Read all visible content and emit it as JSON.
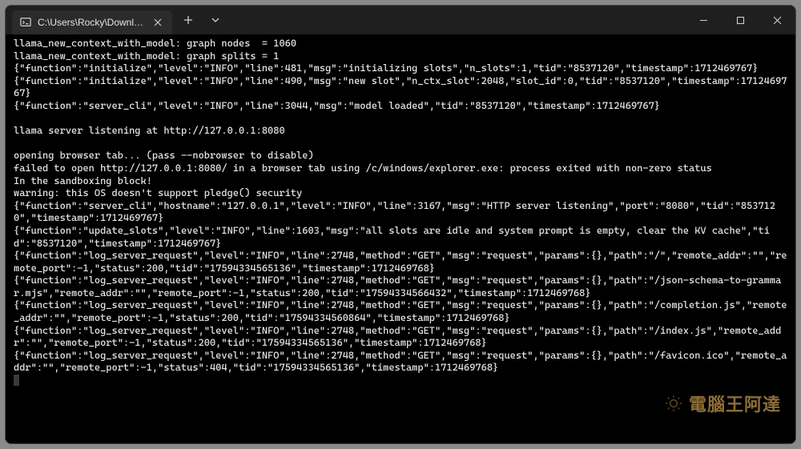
{
  "title": "C:\\Users\\Rocky\\Downloads\\la",
  "terminal_lines": [
    "llama_new_context_with_model: graph nodes  = 1060",
    "llama_new_context_with_model: graph splits = 1",
    "{\"function\":\"initialize\",\"level\":\"INFO\",\"line\":481,\"msg\":\"initializing slots\",\"n_slots\":1,\"tid\":\"8537120\",\"timestamp\":1712469767}",
    "{\"function\":\"initialize\",\"level\":\"INFO\",\"line\":490,\"msg\":\"new slot\",\"n_ctx_slot\":2048,\"slot_id\":0,\"tid\":\"8537120\",\"timestamp\":1712469767}",
    "{\"function\":\"server_cli\",\"level\":\"INFO\",\"line\":3044,\"msg\":\"model loaded\",\"tid\":\"8537120\",\"timestamp\":1712469767}",
    "",
    "llama server listening at http://127.0.0.1:8080",
    "",
    "opening browser tab... (pass --nobrowser to disable)",
    "failed to open http://127.0.0.1:8080/ in a browser tab using /c/windows/explorer.exe: process exited with non-zero status",
    "In the sandboxing block!",
    "warning: this OS doesn't support pledge() security",
    "{\"function\":\"server_cli\",\"hostname\":\"127.0.0.1\",\"level\":\"INFO\",\"line\":3167,\"msg\":\"HTTP server listening\",\"port\":\"8080\",\"tid\":\"8537120\",\"timestamp\":1712469767}",
    "{\"function\":\"update_slots\",\"level\":\"INFO\",\"line\":1603,\"msg\":\"all slots are idle and system prompt is empty, clear the KV cache\",\"tid\":\"8537120\",\"timestamp\":1712469767}",
    "{\"function\":\"log_server_request\",\"level\":\"INFO\",\"line\":2748,\"method\":\"GET\",\"msg\":\"request\",\"params\":{},\"path\":\"/\",\"remote_addr\":\"\",\"remote_port\":-1,\"status\":200,\"tid\":\"17594334565136\",\"timestamp\":1712469768}",
    "{\"function\":\"log_server_request\",\"level\":\"INFO\",\"line\":2748,\"method\":\"GET\",\"msg\":\"request\",\"params\":{},\"path\":\"/json-schema-to-grammar.mjs\",\"remote_addr\":\"\",\"remote_port\":-1,\"status\":200,\"tid\":\"17594334566432\",\"timestamp\":1712469768}",
    "{\"function\":\"log_server_request\",\"level\":\"INFO\",\"line\":2748,\"method\":\"GET\",\"msg\":\"request\",\"params\":{},\"path\":\"/completion.js\",\"remote_addr\":\"\",\"remote_port\":-1,\"status\":200,\"tid\":\"17594334560864\",\"timestamp\":1712469768}",
    "{\"function\":\"log_server_request\",\"level\":\"INFO\",\"line\":2748,\"method\":\"GET\",\"msg\":\"request\",\"params\":{},\"path\":\"/index.js\",\"remote_addr\":\"\",\"remote_port\":-1,\"status\":200,\"tid\":\"17594334565136\",\"timestamp\":1712469768}",
    "{\"function\":\"log_server_request\",\"level\":\"INFO\",\"line\":2748,\"method\":\"GET\",\"msg\":\"request\",\"params\":{},\"path\":\"/favicon.ico\",\"remote_addr\":\"\",\"remote_port\":-1,\"status\":404,\"tid\":\"17594334565136\",\"timestamp\":1712469768}"
  ],
  "watermark": "電腦王阿達"
}
